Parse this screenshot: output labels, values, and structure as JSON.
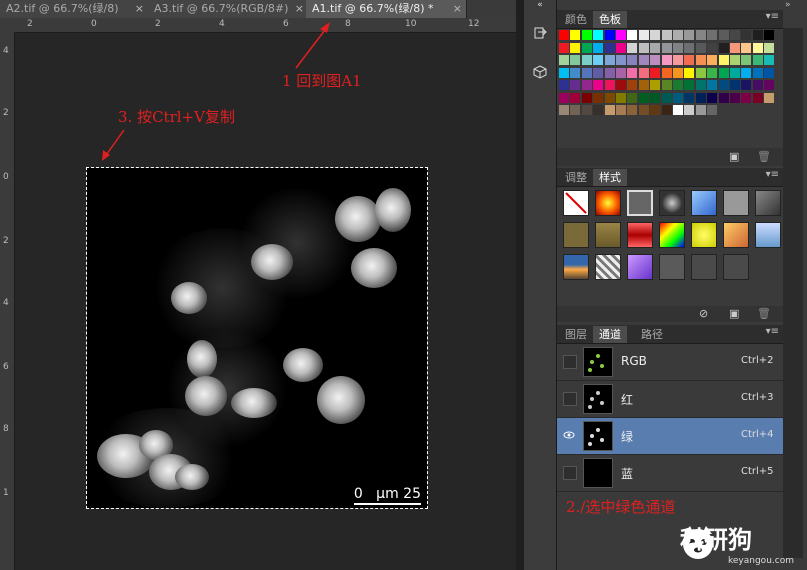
{
  "tabs": [
    {
      "label": "A2.tif @ 66.7%(绿/8)",
      "active": false
    },
    {
      "label": "A3.tif @ 66.7%(RGB/8#)",
      "active": false
    },
    {
      "label": "A1.tif @ 66.7%(绿/8) *",
      "active": true
    }
  ],
  "tab_close": "×",
  "ruler_top_labels": [
    "2",
    "0",
    "2",
    "4",
    "6",
    "8",
    "10",
    "12"
  ],
  "ruler_left_labels": [
    "4",
    "2",
    "0",
    "2",
    "4",
    "6",
    "8",
    "1"
  ],
  "scalebar": {
    "start": "0",
    "unit": "μm",
    "end": "25"
  },
  "annotations": {
    "step1": "1 回到图A1",
    "step2": "2./选中绿色通道",
    "step3": "3. 按Ctrl+V复制"
  },
  "dock": {
    "collapse": "«",
    "collapse2": "»"
  },
  "color_panel": {
    "tabs": [
      "颜色",
      "色板"
    ],
    "active": "色板"
  },
  "adjust_panel": {
    "tabs": [
      "调整",
      "样式"
    ],
    "active": "样式"
  },
  "channels_panel": {
    "tabs": [
      "图层",
      "通道",
      "路径"
    ],
    "active": "通道"
  },
  "channels": [
    {
      "name": "RGB",
      "shortcut": "Ctrl+2",
      "visible": false,
      "selected": false
    },
    {
      "name": "红",
      "shortcut": "Ctrl+3",
      "visible": false,
      "selected": false
    },
    {
      "name": "绿",
      "shortcut": "Ctrl+4",
      "visible": true,
      "selected": true
    },
    {
      "name": "蓝",
      "shortcut": "Ctrl+5",
      "visible": false,
      "selected": false
    }
  ],
  "logo": {
    "text": "科研狗",
    "sub": "keyangou.com"
  },
  "colors": {
    "annotation": "#e02020",
    "selected_row": "#5a7db0"
  }
}
